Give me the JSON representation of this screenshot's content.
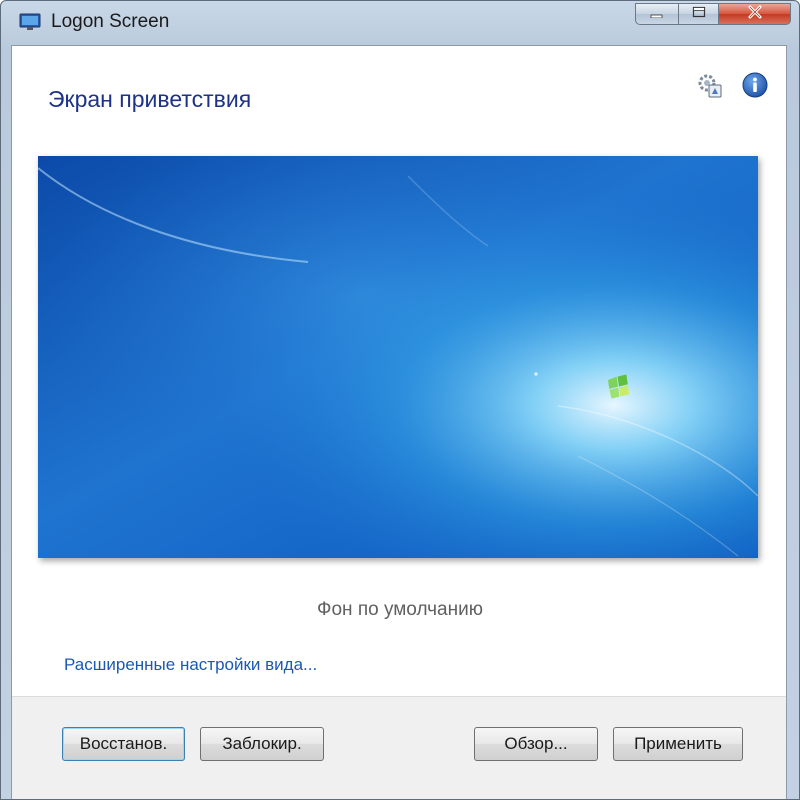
{
  "window": {
    "title": "Logon Screen"
  },
  "main": {
    "heading": "Экран приветствия",
    "preview_caption": "Фон по умолчанию",
    "advanced_link": "Расширенные настройки вида..."
  },
  "buttons": {
    "restore": "Восстанов.",
    "lock": "Заблокир.",
    "browse": "Обзор...",
    "apply": "Применить"
  },
  "icons": {
    "app": "monitor-icon",
    "tools": "settings-tools-icon",
    "info": "info-icon",
    "minimize": "minimize-icon",
    "maximize": "maximize-icon",
    "close": "close-icon"
  },
  "colors": {
    "heading": "#1e3287",
    "link": "#1a58b6",
    "close_button": "#c43a21",
    "wallpaper_base": "#1f67c5"
  }
}
